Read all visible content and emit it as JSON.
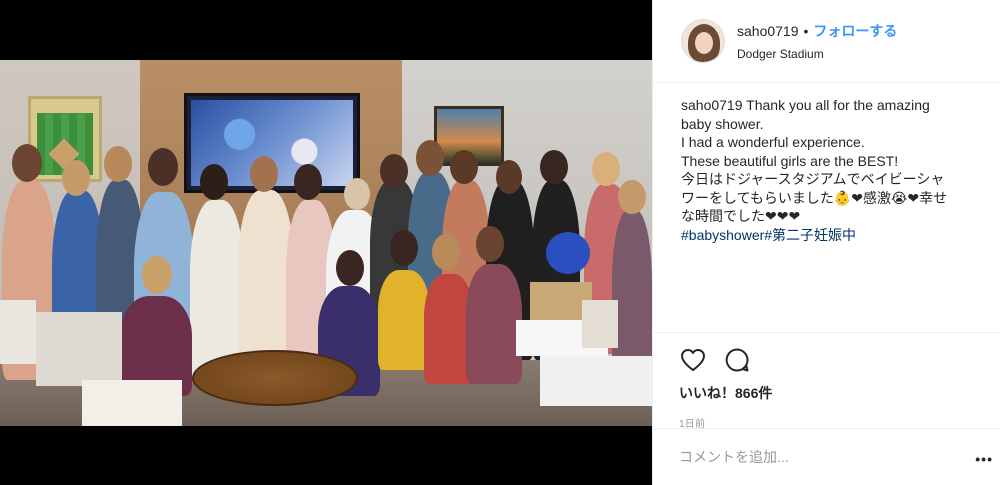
{
  "post": {
    "image_alt": "Group photo at baby shower",
    "header": {
      "username": "saho0719",
      "separator": "•",
      "follow_label": "フォローする",
      "location": "Dodger Stadium"
    },
    "caption": {
      "username": "saho0719",
      "lines": [
        " Thank you all for the amazing",
        "baby shower.",
        "I had a wonderful experience.",
        "These beautiful girls are the BEST!",
        "今日はドジャースタジアムでベイビーシャ",
        "ワーをしてもらいました👶❤感激😭❤幸せ",
        "な時間でした❤❤❤"
      ],
      "hashtags": "#babyshower#第二子妊娠中"
    },
    "actions": {
      "like_icon": "heart-icon",
      "comment_icon": "comment-icon"
    },
    "likes_text": "いいね！866件",
    "timestamp": "1日前",
    "comment": {
      "placeholder": "コメントを追加...",
      "more_label": "•••"
    }
  },
  "colors": {
    "link_blue": "#3897f0",
    "hashtag_blue": "#003569",
    "muted": "#999999",
    "text": "#262626",
    "divider": "#efefef"
  }
}
